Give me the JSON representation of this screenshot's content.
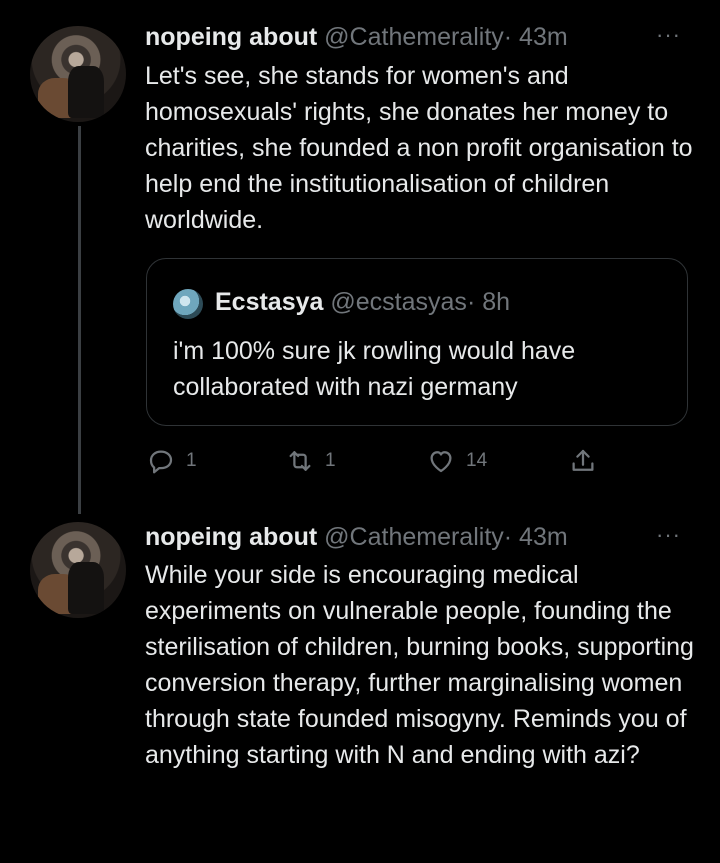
{
  "tweets": [
    {
      "name": "nopeing about",
      "handle": "@Cathemerality",
      "time": "· 43m",
      "more": "···",
      "text": "Let's see, she stands for women's and homosexuals' rights, she donates her money to charities, she founded a non profit organisation to help end the institutionalisation of children worldwide.",
      "quote": {
        "name": "Ecstasya",
        "handle": "@ecstasyas",
        "time": "· 8h",
        "text": "i'm 100% sure jk rowling would have collaborated with nazi germany"
      },
      "actions": {
        "reply_icon": "reply-icon",
        "replies": "1",
        "retweet_icon": "retweet-icon",
        "retweets": "1",
        "like_icon": "heart-icon",
        "likes": "14",
        "share_icon": "share-icon"
      }
    },
    {
      "name": "nopeing about",
      "handle": "@Cathemerality",
      "time": "· 43m",
      "more": "···",
      "text": "While your side is encouraging medical experiments on vulnerable people, founding the sterilisation of children, burning books, supporting conversion therapy, further marginalising women through state founded misogyny. Reminds you of anything starting with N and ending with azi?"
    }
  ],
  "colors": {
    "background": "#000000",
    "text": "#e7e9ea",
    "secondary": "#71767b",
    "border": "#2f3336"
  }
}
